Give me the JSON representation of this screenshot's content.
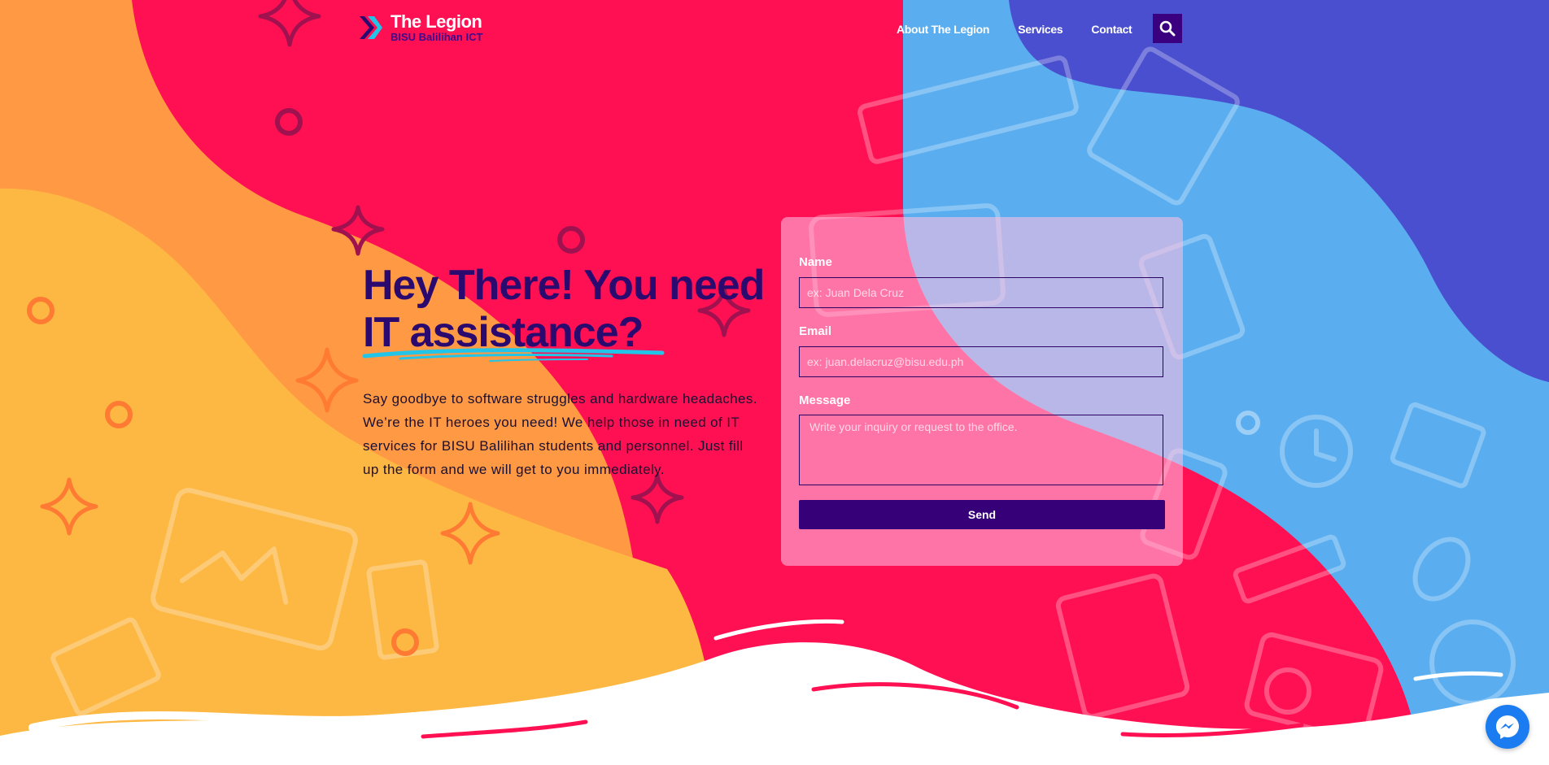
{
  "colors": {
    "orange": "#ff9944",
    "yellow": "#fdb843",
    "pink": "#ff1053",
    "blue": "#5aaef0",
    "indigo": "#4a4fcf",
    "navy": "#2a0a6e",
    "cyan": "#22c5e8"
  },
  "header": {
    "brand_title": "The Legion",
    "brand_subtitle": "BISU Balilihan ICT",
    "nav": [
      "About The Legion",
      "Services",
      "Contact"
    ],
    "search_icon": "search-icon"
  },
  "hero": {
    "title_part1": "Hey There! You need",
    "title_highlight": "IT assistance?",
    "description": "Say goodbye to software struggles and hardware headaches. We’re the IT heroes you need! We help those in need of IT services for BISU Balilihan students and personnel. Just fill up the form and we will get to you immediately."
  },
  "form": {
    "name_label": "Name",
    "name_placeholder": "ex: Juan Dela Cruz",
    "email_label": "Email",
    "email_placeholder": "ex: juan.delacruz@bisu.edu.ph",
    "message_label": "Message",
    "message_placeholder": "Write your inquiry or request to the office.",
    "send_label": "Send"
  },
  "chat": {
    "icon": "messenger-icon"
  }
}
